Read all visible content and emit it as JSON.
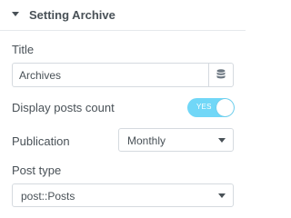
{
  "section": {
    "title": "Setting Archive",
    "icon": "caret-down-icon"
  },
  "title_field": {
    "label": "Title",
    "value": "Archives",
    "icon": "database-icon"
  },
  "display_posts_count": {
    "label": "Display posts count",
    "toggle_text": "YES",
    "enabled": true,
    "accent": "#71d7f7"
  },
  "publication": {
    "label": "Publication",
    "value": "Monthly"
  },
  "post_type": {
    "label": "Post type",
    "value": "post::Posts"
  }
}
